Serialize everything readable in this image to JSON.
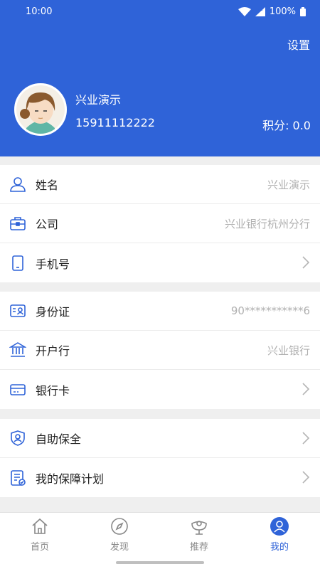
{
  "status_bar": {
    "time": "10:00",
    "battery": "100%"
  },
  "header": {
    "settings_label": "设置",
    "username": "兴业演示",
    "phone": "15911112222",
    "points": "积分: 0.0"
  },
  "sections": [
    [
      {
        "label": "姓名",
        "value": "兴业演示",
        "icon": "user-icon"
      },
      {
        "label": "公司",
        "value": "兴业银行杭州分行",
        "icon": "briefcase-icon"
      },
      {
        "label": "手机号",
        "value": "",
        "icon": "mobile-phone-icon"
      }
    ],
    [
      {
        "label": "身份证",
        "value": "90***********6",
        "icon": "id-card-icon"
      },
      {
        "label": "开户行",
        "value": "兴业银行",
        "icon": "bank-icon"
      },
      {
        "label": "银行卡",
        "value": "",
        "icon": "bank-card-icon"
      }
    ],
    [
      {
        "label": "自助保全",
        "value": "",
        "icon": "shield-user-icon"
      },
      {
        "label": "我的保障计划",
        "value": "",
        "icon": "plan-document-icon"
      }
    ]
  ],
  "tabs": [
    {
      "label": "首页",
      "icon": "home-icon"
    },
    {
      "label": "发现",
      "icon": "compass-icon"
    },
    {
      "label": "推荐",
      "icon": "recommend-icon"
    },
    {
      "label": "我的",
      "icon": "profile-icon"
    }
  ],
  "colors": {
    "brand": "#2f63d8",
    "accent": "#2f63d8",
    "value_gray": "#b0b0b0"
  }
}
